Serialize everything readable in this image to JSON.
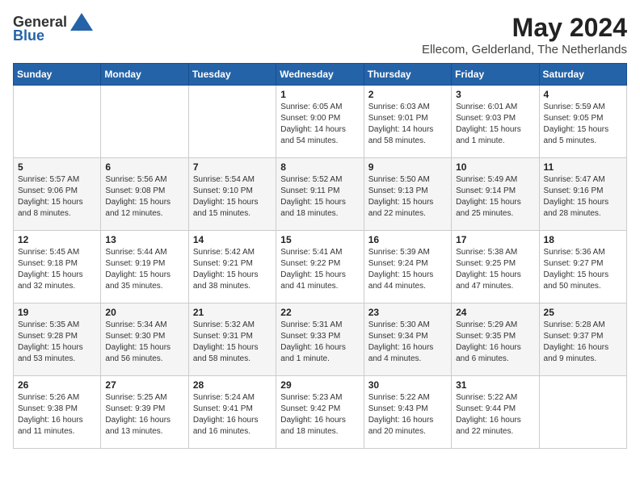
{
  "logo": {
    "general": "General",
    "blue": "Blue"
  },
  "title": "May 2024",
  "location": "Ellecom, Gelderland, The Netherlands",
  "headers": [
    "Sunday",
    "Monday",
    "Tuesday",
    "Wednesday",
    "Thursday",
    "Friday",
    "Saturday"
  ],
  "weeks": [
    [
      {
        "day": "",
        "sunrise": "",
        "sunset": "",
        "daylight": ""
      },
      {
        "day": "",
        "sunrise": "",
        "sunset": "",
        "daylight": ""
      },
      {
        "day": "",
        "sunrise": "",
        "sunset": "",
        "daylight": ""
      },
      {
        "day": "1",
        "sunrise": "Sunrise: 6:05 AM",
        "sunset": "Sunset: 9:00 PM",
        "daylight": "Daylight: 14 hours and 54 minutes."
      },
      {
        "day": "2",
        "sunrise": "Sunrise: 6:03 AM",
        "sunset": "Sunset: 9:01 PM",
        "daylight": "Daylight: 14 hours and 58 minutes."
      },
      {
        "day": "3",
        "sunrise": "Sunrise: 6:01 AM",
        "sunset": "Sunset: 9:03 PM",
        "daylight": "Daylight: 15 hours and 1 minute."
      },
      {
        "day": "4",
        "sunrise": "Sunrise: 5:59 AM",
        "sunset": "Sunset: 9:05 PM",
        "daylight": "Daylight: 15 hours and 5 minutes."
      }
    ],
    [
      {
        "day": "5",
        "sunrise": "Sunrise: 5:57 AM",
        "sunset": "Sunset: 9:06 PM",
        "daylight": "Daylight: 15 hours and 8 minutes."
      },
      {
        "day": "6",
        "sunrise": "Sunrise: 5:56 AM",
        "sunset": "Sunset: 9:08 PM",
        "daylight": "Daylight: 15 hours and 12 minutes."
      },
      {
        "day": "7",
        "sunrise": "Sunrise: 5:54 AM",
        "sunset": "Sunset: 9:10 PM",
        "daylight": "Daylight: 15 hours and 15 minutes."
      },
      {
        "day": "8",
        "sunrise": "Sunrise: 5:52 AM",
        "sunset": "Sunset: 9:11 PM",
        "daylight": "Daylight: 15 hours and 18 minutes."
      },
      {
        "day": "9",
        "sunrise": "Sunrise: 5:50 AM",
        "sunset": "Sunset: 9:13 PM",
        "daylight": "Daylight: 15 hours and 22 minutes."
      },
      {
        "day": "10",
        "sunrise": "Sunrise: 5:49 AM",
        "sunset": "Sunset: 9:14 PM",
        "daylight": "Daylight: 15 hours and 25 minutes."
      },
      {
        "day": "11",
        "sunrise": "Sunrise: 5:47 AM",
        "sunset": "Sunset: 9:16 PM",
        "daylight": "Daylight: 15 hours and 28 minutes."
      }
    ],
    [
      {
        "day": "12",
        "sunrise": "Sunrise: 5:45 AM",
        "sunset": "Sunset: 9:18 PM",
        "daylight": "Daylight: 15 hours and 32 minutes."
      },
      {
        "day": "13",
        "sunrise": "Sunrise: 5:44 AM",
        "sunset": "Sunset: 9:19 PM",
        "daylight": "Daylight: 15 hours and 35 minutes."
      },
      {
        "day": "14",
        "sunrise": "Sunrise: 5:42 AM",
        "sunset": "Sunset: 9:21 PM",
        "daylight": "Daylight: 15 hours and 38 minutes."
      },
      {
        "day": "15",
        "sunrise": "Sunrise: 5:41 AM",
        "sunset": "Sunset: 9:22 PM",
        "daylight": "Daylight: 15 hours and 41 minutes."
      },
      {
        "day": "16",
        "sunrise": "Sunrise: 5:39 AM",
        "sunset": "Sunset: 9:24 PM",
        "daylight": "Daylight: 15 hours and 44 minutes."
      },
      {
        "day": "17",
        "sunrise": "Sunrise: 5:38 AM",
        "sunset": "Sunset: 9:25 PM",
        "daylight": "Daylight: 15 hours and 47 minutes."
      },
      {
        "day": "18",
        "sunrise": "Sunrise: 5:36 AM",
        "sunset": "Sunset: 9:27 PM",
        "daylight": "Daylight: 15 hours and 50 minutes."
      }
    ],
    [
      {
        "day": "19",
        "sunrise": "Sunrise: 5:35 AM",
        "sunset": "Sunset: 9:28 PM",
        "daylight": "Daylight: 15 hours and 53 minutes."
      },
      {
        "day": "20",
        "sunrise": "Sunrise: 5:34 AM",
        "sunset": "Sunset: 9:30 PM",
        "daylight": "Daylight: 15 hours and 56 minutes."
      },
      {
        "day": "21",
        "sunrise": "Sunrise: 5:32 AM",
        "sunset": "Sunset: 9:31 PM",
        "daylight": "Daylight: 15 hours and 58 minutes."
      },
      {
        "day": "22",
        "sunrise": "Sunrise: 5:31 AM",
        "sunset": "Sunset: 9:33 PM",
        "daylight": "Daylight: 16 hours and 1 minute."
      },
      {
        "day": "23",
        "sunrise": "Sunrise: 5:30 AM",
        "sunset": "Sunset: 9:34 PM",
        "daylight": "Daylight: 16 hours and 4 minutes."
      },
      {
        "day": "24",
        "sunrise": "Sunrise: 5:29 AM",
        "sunset": "Sunset: 9:35 PM",
        "daylight": "Daylight: 16 hours and 6 minutes."
      },
      {
        "day": "25",
        "sunrise": "Sunrise: 5:28 AM",
        "sunset": "Sunset: 9:37 PM",
        "daylight": "Daylight: 16 hours and 9 minutes."
      }
    ],
    [
      {
        "day": "26",
        "sunrise": "Sunrise: 5:26 AM",
        "sunset": "Sunset: 9:38 PM",
        "daylight": "Daylight: 16 hours and 11 minutes."
      },
      {
        "day": "27",
        "sunrise": "Sunrise: 5:25 AM",
        "sunset": "Sunset: 9:39 PM",
        "daylight": "Daylight: 16 hours and 13 minutes."
      },
      {
        "day": "28",
        "sunrise": "Sunrise: 5:24 AM",
        "sunset": "Sunset: 9:41 PM",
        "daylight": "Daylight: 16 hours and 16 minutes."
      },
      {
        "day": "29",
        "sunrise": "Sunrise: 5:23 AM",
        "sunset": "Sunset: 9:42 PM",
        "daylight": "Daylight: 16 hours and 18 minutes."
      },
      {
        "day": "30",
        "sunrise": "Sunrise: 5:22 AM",
        "sunset": "Sunset: 9:43 PM",
        "daylight": "Daylight: 16 hours and 20 minutes."
      },
      {
        "day": "31",
        "sunrise": "Sunrise: 5:22 AM",
        "sunset": "Sunset: 9:44 PM",
        "daylight": "Daylight: 16 hours and 22 minutes."
      },
      {
        "day": "",
        "sunrise": "",
        "sunset": "",
        "daylight": ""
      }
    ]
  ]
}
